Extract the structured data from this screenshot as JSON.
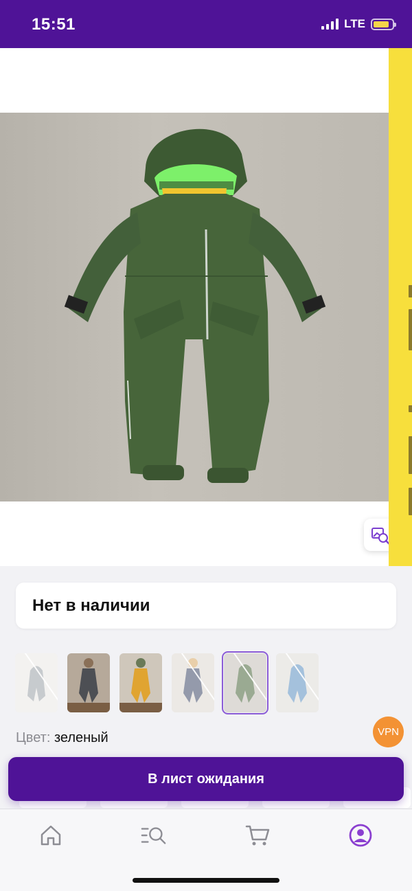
{
  "status_bar": {
    "time": "15:51",
    "network": "LTE",
    "background_color": "#4f1397",
    "battery_color": "#f6d54a"
  },
  "navigation": {
    "back_icon": "chevron-left-icon",
    "share_icon": "share-icon"
  },
  "product": {
    "image_subject": "green children's winter snowsuit",
    "image_search_icon": "image-search-icon",
    "availability": "Нет в наличии",
    "color_label": "Цвет:",
    "color_value": "зеленый",
    "variant_thumbnails": [
      {
        "color": "grey",
        "out_of_stock": true,
        "selected": false
      },
      {
        "color": "dark-grey",
        "out_of_stock": false,
        "selected": false
      },
      {
        "color": "yellow",
        "out_of_stock": false,
        "selected": false
      },
      {
        "color": "navy",
        "out_of_stock": true,
        "selected": false
      },
      {
        "color": "green",
        "out_of_stock": true,
        "selected": true
      },
      {
        "color": "blue",
        "out_of_stock": true,
        "selected": false
      }
    ]
  },
  "vpn_badge": "VPN",
  "action": {
    "waitlist_button": "В лист ожидания",
    "accent_color": "#4f1397"
  },
  "tab_bar": {
    "items": [
      {
        "name": "home",
        "icon": "home-icon",
        "active": false
      },
      {
        "name": "catalog",
        "icon": "catalog-search-icon",
        "active": false
      },
      {
        "name": "cart",
        "icon": "cart-icon",
        "active": false
      },
      {
        "name": "profile",
        "icon": "profile-icon",
        "active": true
      }
    ],
    "active_color": "#8b3fd0"
  }
}
